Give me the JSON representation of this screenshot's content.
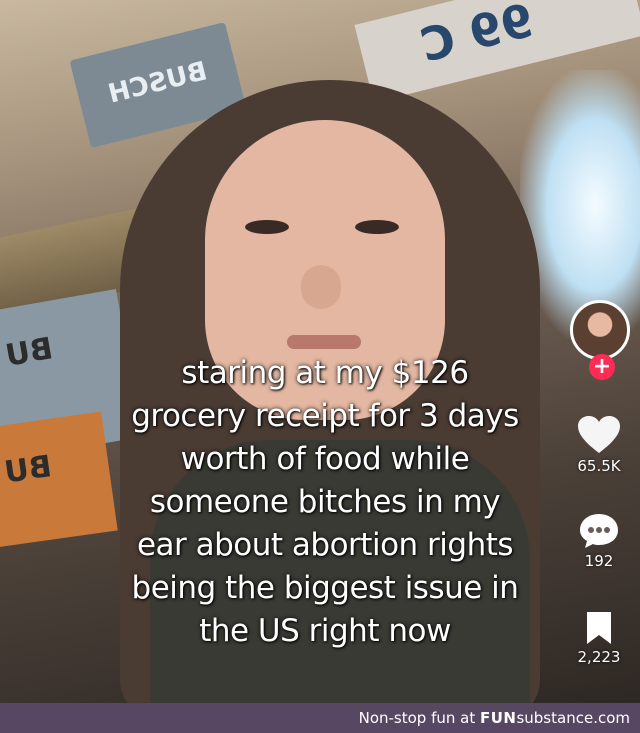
{
  "background": {
    "box_label_1": "BUSCH",
    "box_label_2": "BU",
    "box_label_3": "BU",
    "sign_text": "99 C"
  },
  "caption": {
    "lines": [
      "staring at my $126",
      "grocery receipt for 3 days",
      "worth of food while",
      "someone bitches in my",
      "ear about abortion rights",
      "being the biggest issue in",
      "the US right now"
    ]
  },
  "sidebar": {
    "follow_symbol": "+",
    "likes": "65.5K",
    "comments": "192",
    "saves": "2,223"
  },
  "footer": {
    "prefix": "Non-stop fun at ",
    "brand_bold": "FUN",
    "brand_rest": "substance",
    "suffix": ".com"
  },
  "colors": {
    "follow": "#fe2c55",
    "footer_bg": "#584762"
  }
}
